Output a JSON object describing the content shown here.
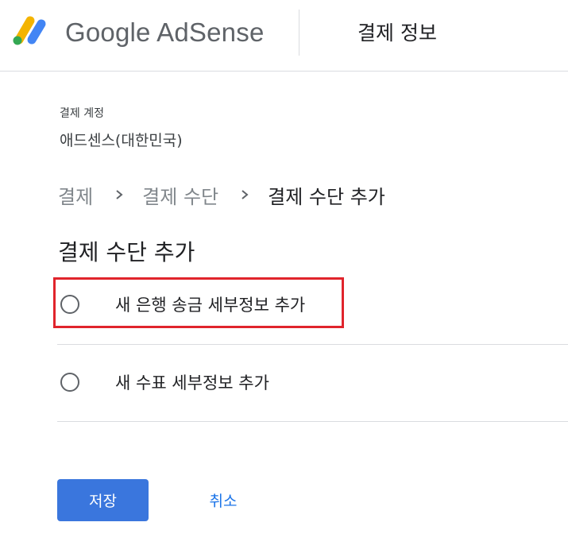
{
  "header": {
    "brand": "Google AdSense",
    "title": "결제 정보"
  },
  "account": {
    "label": "결제 계정",
    "value": "애드센스(대한민국)"
  },
  "breadcrumb": {
    "items": [
      "결제",
      "결제 수단",
      "결제 수단 추가"
    ]
  },
  "section": {
    "title": "결제 수단 추가"
  },
  "options": [
    {
      "label": "새 은행 송금 세부정보 추가",
      "selected": false,
      "highlighted": true
    },
    {
      "label": "새 수표 세부정보 추가",
      "selected": false,
      "highlighted": false
    }
  ],
  "actions": {
    "save_label": "저장",
    "cancel_label": "취소"
  },
  "colors": {
    "primary": "#3a76dd",
    "link": "#1a73e8",
    "highlight_box": "#e0242c",
    "logo_yellow": "#f4b400",
    "logo_blue": "#4285f4"
  }
}
